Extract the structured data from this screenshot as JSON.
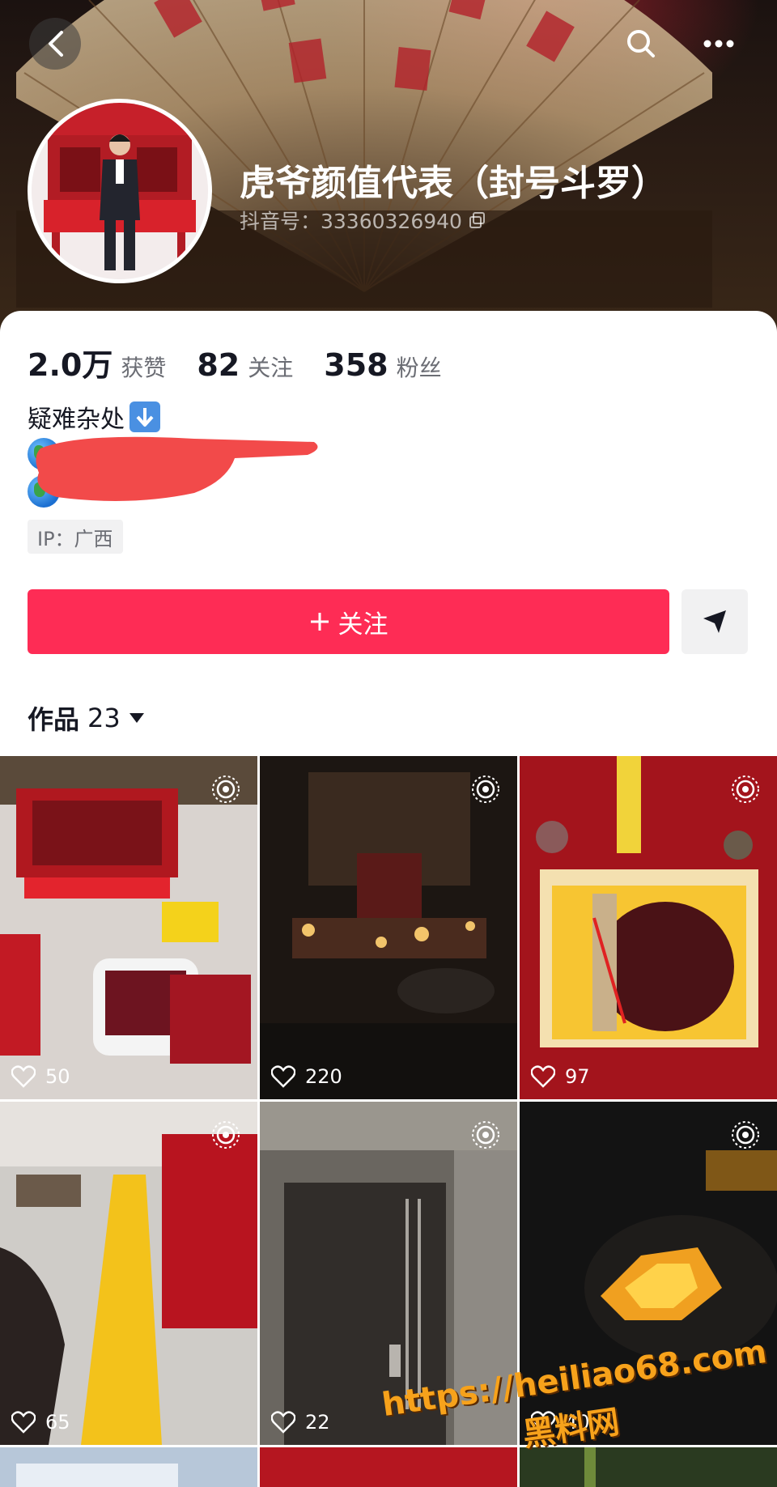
{
  "header": {
    "nickname": "虎爷颜值代表（封号斗罗）",
    "douyin_id": "抖音号：33360326940"
  },
  "stats": [
    {
      "value": "2.0万",
      "label": "获赞"
    },
    {
      "value": "82",
      "label": "关注"
    },
    {
      "value": "358",
      "label": "粉丝"
    }
  ],
  "bio": {
    "line1": "疑难杂处"
  },
  "ip_location": "IP：广西",
  "actions": {
    "follow_label": "关注"
  },
  "works": {
    "label": "作品",
    "count": "23"
  },
  "videos": [
    {
      "likes": "50"
    },
    {
      "likes": "220"
    },
    {
      "likes": "97"
    },
    {
      "likes": "65"
    },
    {
      "likes": "22"
    },
    {
      "likes": "40"
    }
  ],
  "watermark": {
    "url": "https://heiliao68.com",
    "site": "黑料网"
  },
  "colors": {
    "accent": "#fe2c55",
    "tag_bg": "#f1f1f2"
  }
}
